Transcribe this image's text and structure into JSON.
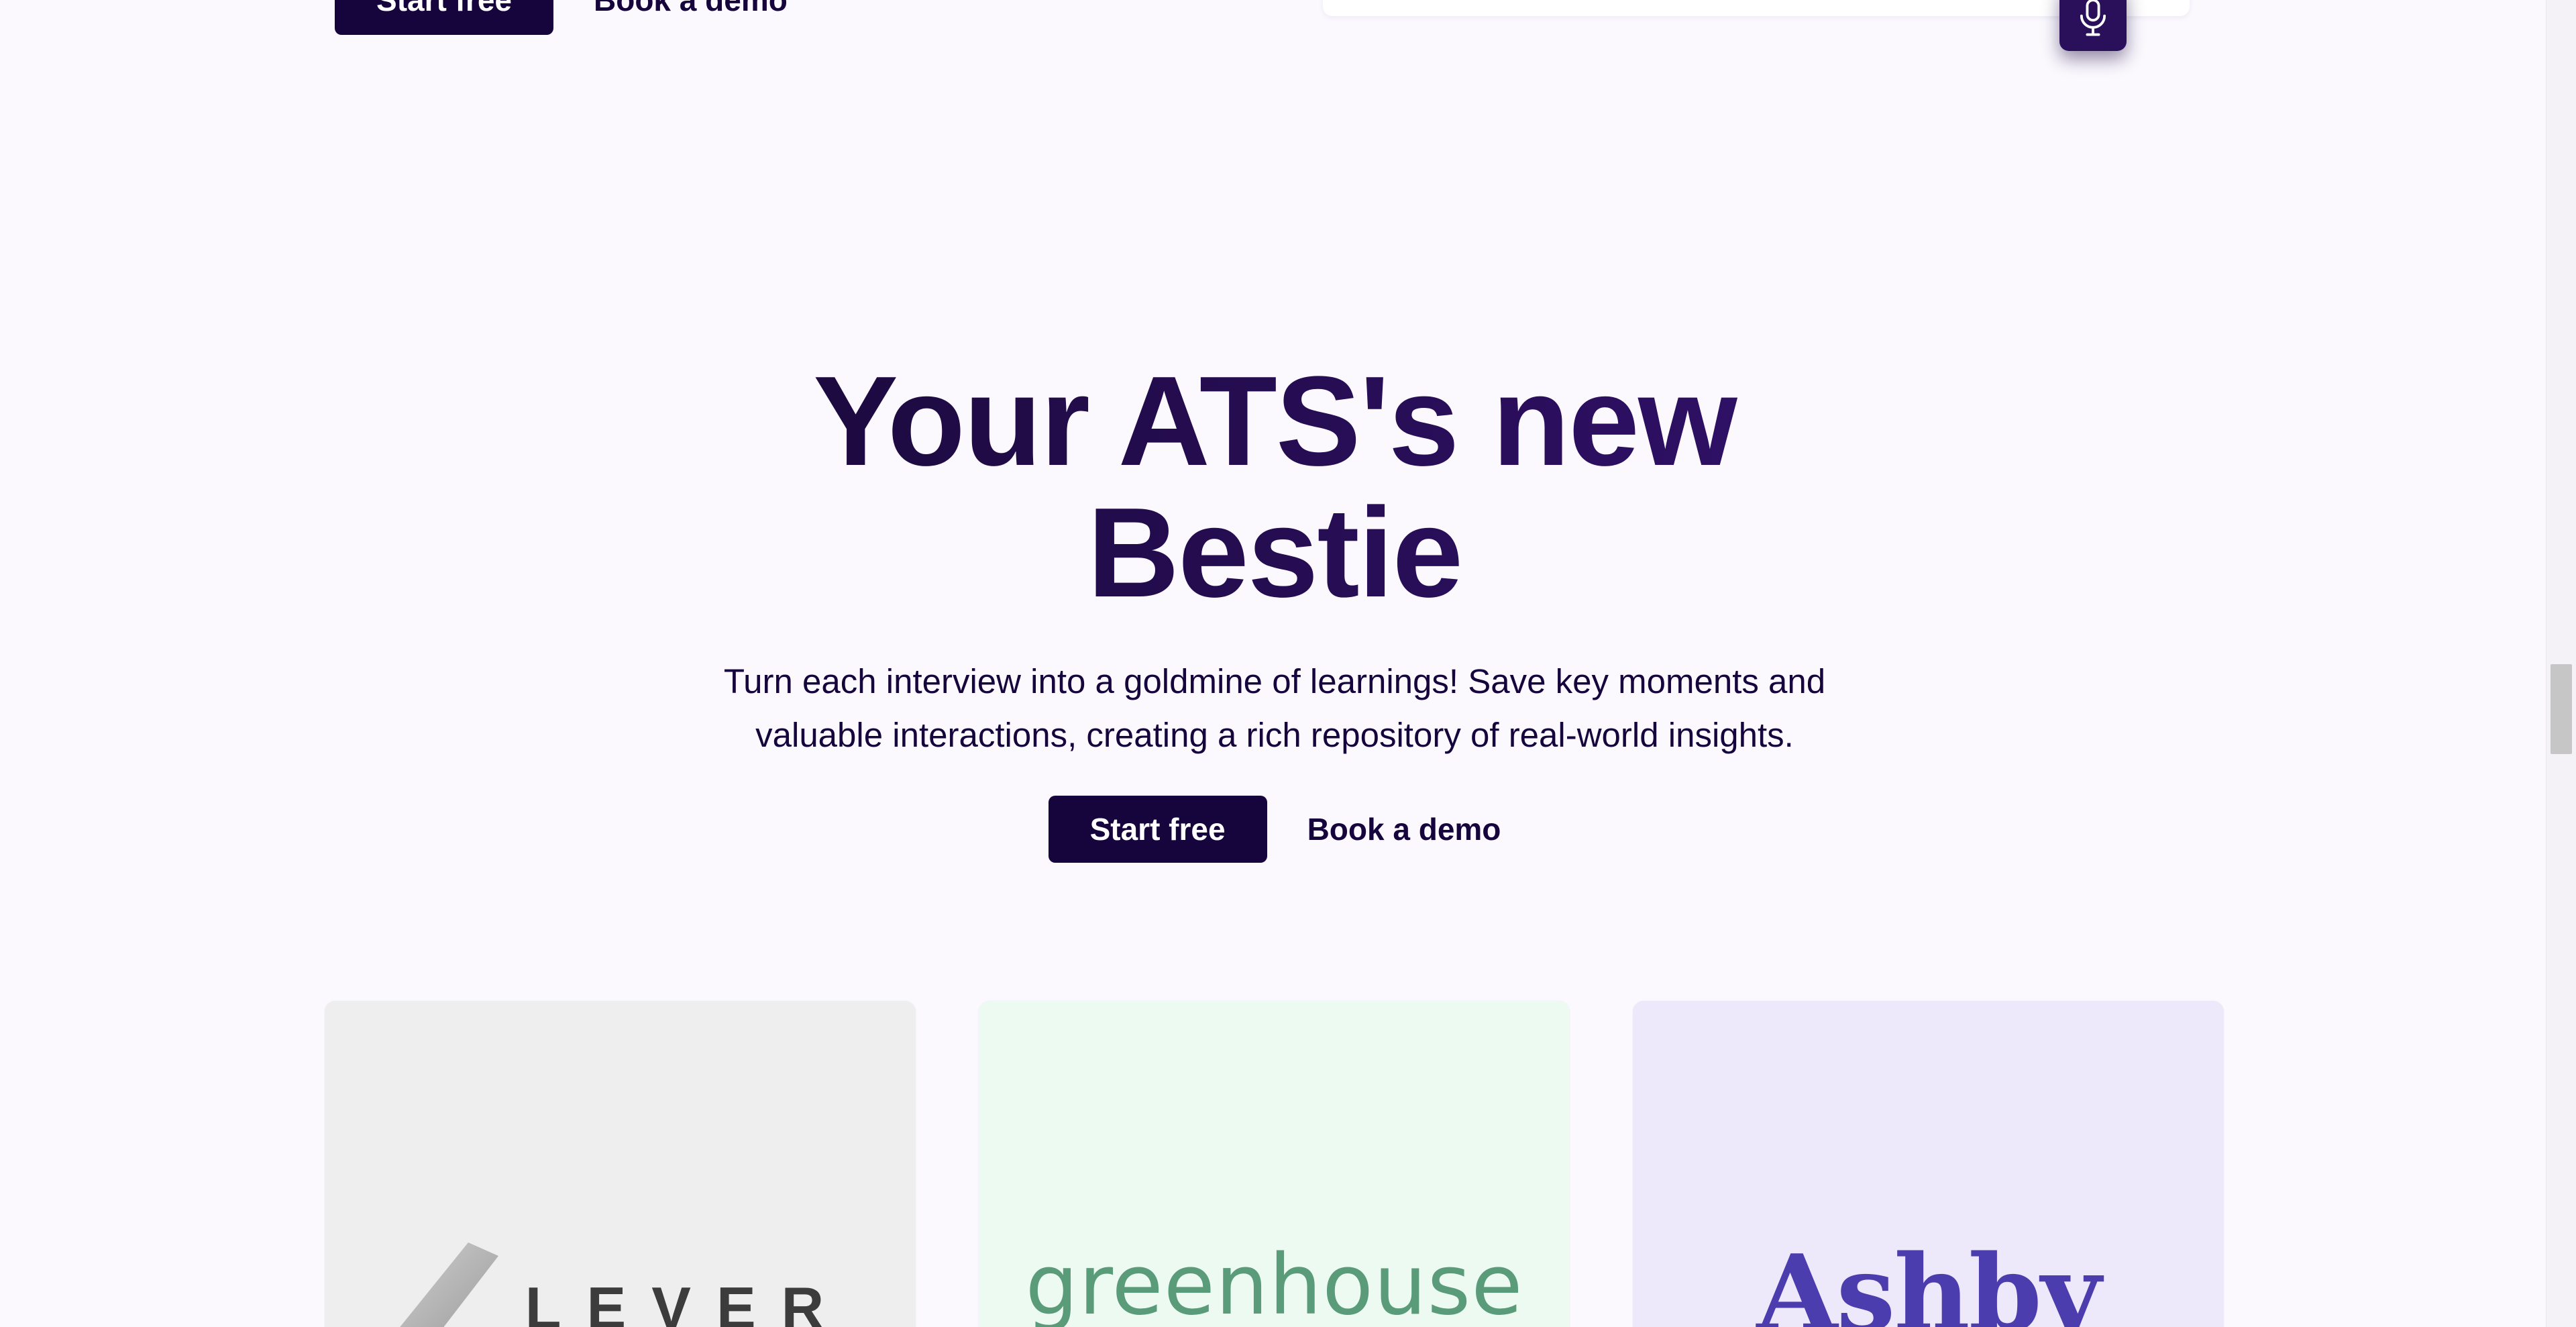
{
  "top_cta": {
    "start_label": "Start free",
    "demo_label": "Book a demo"
  },
  "mic_button": {
    "icon": "microphone-icon"
  },
  "hero": {
    "title_line1": "Your ATS's new",
    "title_line2": "Bestie",
    "subtitle_line1": "Turn each interview into a goldmine of learnings! Save key moments and",
    "subtitle_line2": "valuable interactions, creating a rich repository of real-world insights.",
    "start_label": "Start free",
    "demo_label": "Book a demo"
  },
  "integrations": [
    {
      "name": "LEVER",
      "background": "#eeeeee",
      "color": "#3c3c3c"
    },
    {
      "name": "greenhouse",
      "background": "#edfaf1",
      "color": "#5a9b7a"
    },
    {
      "name": "Ashby",
      "background": "#ede8fa",
      "color": "#4c3dae"
    }
  ],
  "colors": {
    "page_background": "#fbf9fe",
    "primary": "#16053d",
    "title_gradient_start": "#1c0a3e",
    "title_gradient_end": "#2f1066"
  }
}
